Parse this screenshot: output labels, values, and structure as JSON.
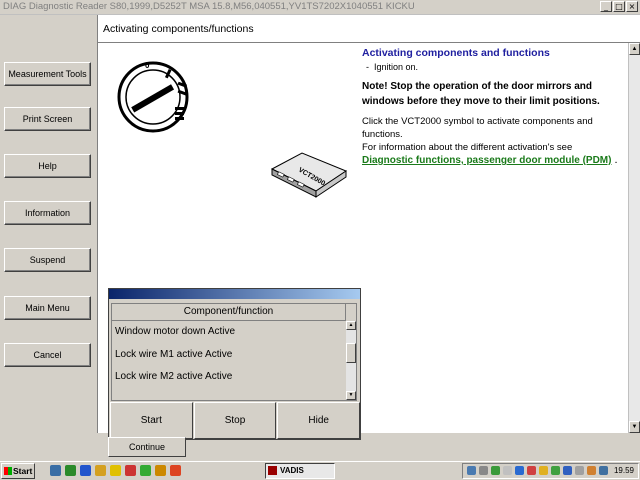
{
  "window": {
    "title": "DIAG Diagnostic Reader S80,1999,D5252T MSA 15.8,M56,040551,YV1TS7202X1040551 KICKU",
    "buttons": [
      "_",
      "□",
      "×"
    ]
  },
  "sidebar": {
    "items": [
      {
        "label": "Measurement Tools"
      },
      {
        "label": "Print Screen"
      },
      {
        "label": "Help"
      },
      {
        "label": "Information"
      },
      {
        "label": "Suspend"
      },
      {
        "label": "Main Menu"
      },
      {
        "label": "Cancel"
      }
    ]
  },
  "header": {
    "title": "Activating components/functions"
  },
  "instructions": {
    "heading": "Activating components and functions",
    "bullet": "Ignition on.",
    "note": "Note! Stop the operation of the door mirrors and windows before they move to their limit positions.",
    "text1": "Click the VCT2000 symbol to activate components and functions.",
    "text2": "For information about the different activation's see",
    "link": "Diagnostic functions, passenger door module (PDM)",
    "link_suffix": "."
  },
  "images": {
    "ignition": "ignition-switch-icon",
    "vct": "vct2000-icon",
    "vct_label": "VCT2000"
  },
  "dialog": {
    "column_header": "Component/function",
    "items": [
      "Window motor down Active",
      "Lock wire M1 active Active",
      "Lock wire M2 active Active"
    ],
    "buttons": {
      "start": "Start",
      "stop": "Stop",
      "hide": "Hide"
    }
  },
  "continue_label": "Continue",
  "taskbar": {
    "start_label": "Start",
    "task_label": "VADIS",
    "clock": "19.59"
  },
  "colors": {
    "heading": "#2020a0",
    "link": "#1a7a1a",
    "dialog_titlebar": "#0a246a"
  }
}
